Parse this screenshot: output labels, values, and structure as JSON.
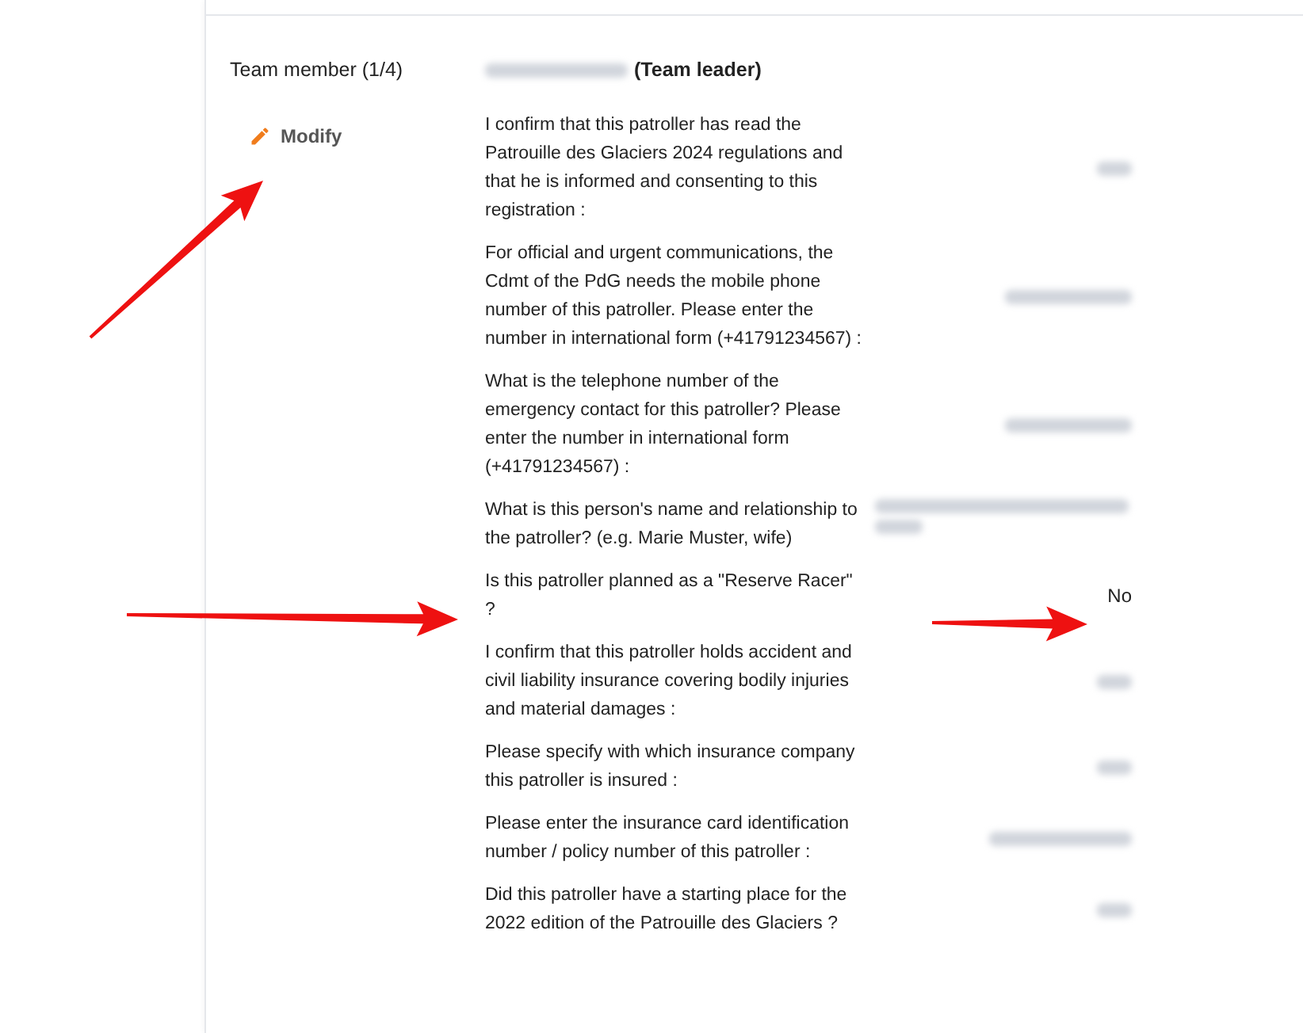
{
  "member": {
    "label": "Team member (1/4)",
    "name": {
      "kind": "blurred"
    },
    "role": "(Team leader)"
  },
  "modify_button": "Modify",
  "answers": [
    {
      "question": "I confirm that this patroller has read the Patrouille des Glaciers 2024 regulations and that he is informed and consenting to this registration :",
      "kind": "blurred"
    },
    {
      "question": "For official and urgent communications, the Cdmt of the PdG needs the mobile phone number of this patroller. Please enter the number in international form (+41791234567) :",
      "kind": "blurred"
    },
    {
      "question": "What is the telephone number of the emergency contact for this patroller? Please enter the number in international form (+41791234567) :",
      "kind": "blurred"
    },
    {
      "question": "What is this person's name and relationship to the patroller? (e.g. Marie Muster, wife)",
      "kind": "blurred"
    },
    {
      "question": "Is this patroller planned as a \"Reserve Racer\" ?",
      "kind": "text",
      "value": "No"
    },
    {
      "question": "I confirm that this patroller holds accident and civil liability insurance covering bodily injuries and material damages :",
      "kind": "blurred"
    },
    {
      "question": "Please specify with which insurance company this patroller is insured :",
      "kind": "blurred"
    },
    {
      "question": "Please enter the insurance card identification number / policy number of this patroller :",
      "kind": "blurred"
    },
    {
      "question": "Did this patroller have a starting place for the 2022 edition of the Patrouille des Glaciers ?",
      "kind": "blurred"
    }
  ]
}
